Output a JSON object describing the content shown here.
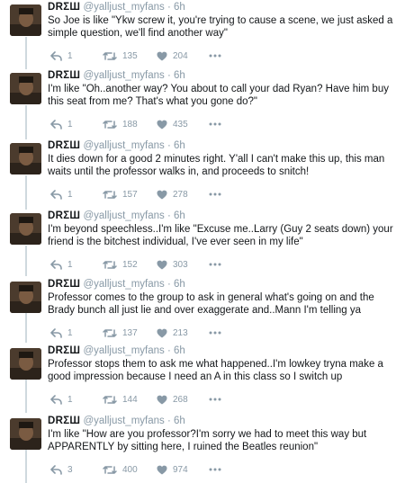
{
  "tweets": [
    {
      "name": "DRΣШ",
      "handle": "@yalljust_myfans",
      "time": "6h",
      "text": "So Joe is like \"Ykw screw it, you're trying to cause a scene, we just asked a simple question, we'll find another way\"",
      "replies": "1",
      "retweets": "135",
      "likes": "204"
    },
    {
      "name": "DRΣШ",
      "handle": "@yalljust_myfans",
      "time": "6h",
      "text": "I'm like \"Oh..another way? You about to call your dad Ryan? Have him buy this seat from me? That's what you gone do?\"",
      "replies": "1",
      "retweets": "188",
      "likes": "435"
    },
    {
      "name": "DRΣШ",
      "handle": "@yalljust_myfans",
      "time": "6h",
      "text": "It dies down for a good 2 minutes right. Y'all I can't make this up, this man waits until the professor walks in, and proceeds to snitch!",
      "replies": "1",
      "retweets": "157",
      "likes": "278"
    },
    {
      "name": "DRΣШ",
      "handle": "@yalljust_myfans",
      "time": "6h",
      "text": "I'm beyond speechless..I'm like \"Excuse me..Larry (Guy 2 seats down) your friend is the bitchest individual, I've ever seen in my life\"",
      "replies": "1",
      "retweets": "152",
      "likes": "303"
    },
    {
      "name": "DRΣШ",
      "handle": "@yalljust_myfans",
      "time": "6h",
      "text": "Professor comes to the group to ask in general what's going on and the Brady bunch all just lie and over exaggerate and..Mann I'm telling ya",
      "replies": "1",
      "retweets": "137",
      "likes": "213"
    },
    {
      "name": "DRΣШ",
      "handle": "@yalljust_myfans",
      "time": "6h",
      "text": "Professor stops them to ask me what happened..I'm lowkey tryna make a good impression because I need an A in this class so I switch up",
      "replies": "1",
      "retweets": "144",
      "likes": "268"
    },
    {
      "name": "DRΣШ",
      "handle": "@yalljust_myfans",
      "time": "6h",
      "text": "I'm like \"How are you professor?I'm sorry we had to meet this way but APPARENTLY by sitting here, I ruined the Beatles reunion\"",
      "replies": "3",
      "retweets": "400",
      "likes": "974"
    }
  ],
  "colors": {
    "text": "#14171a",
    "muted": "#8899a6",
    "thread_line": "#cfd9de"
  },
  "icons": [
    "reply-icon",
    "retweet-icon",
    "like-icon",
    "more-icon",
    "avatar"
  ]
}
